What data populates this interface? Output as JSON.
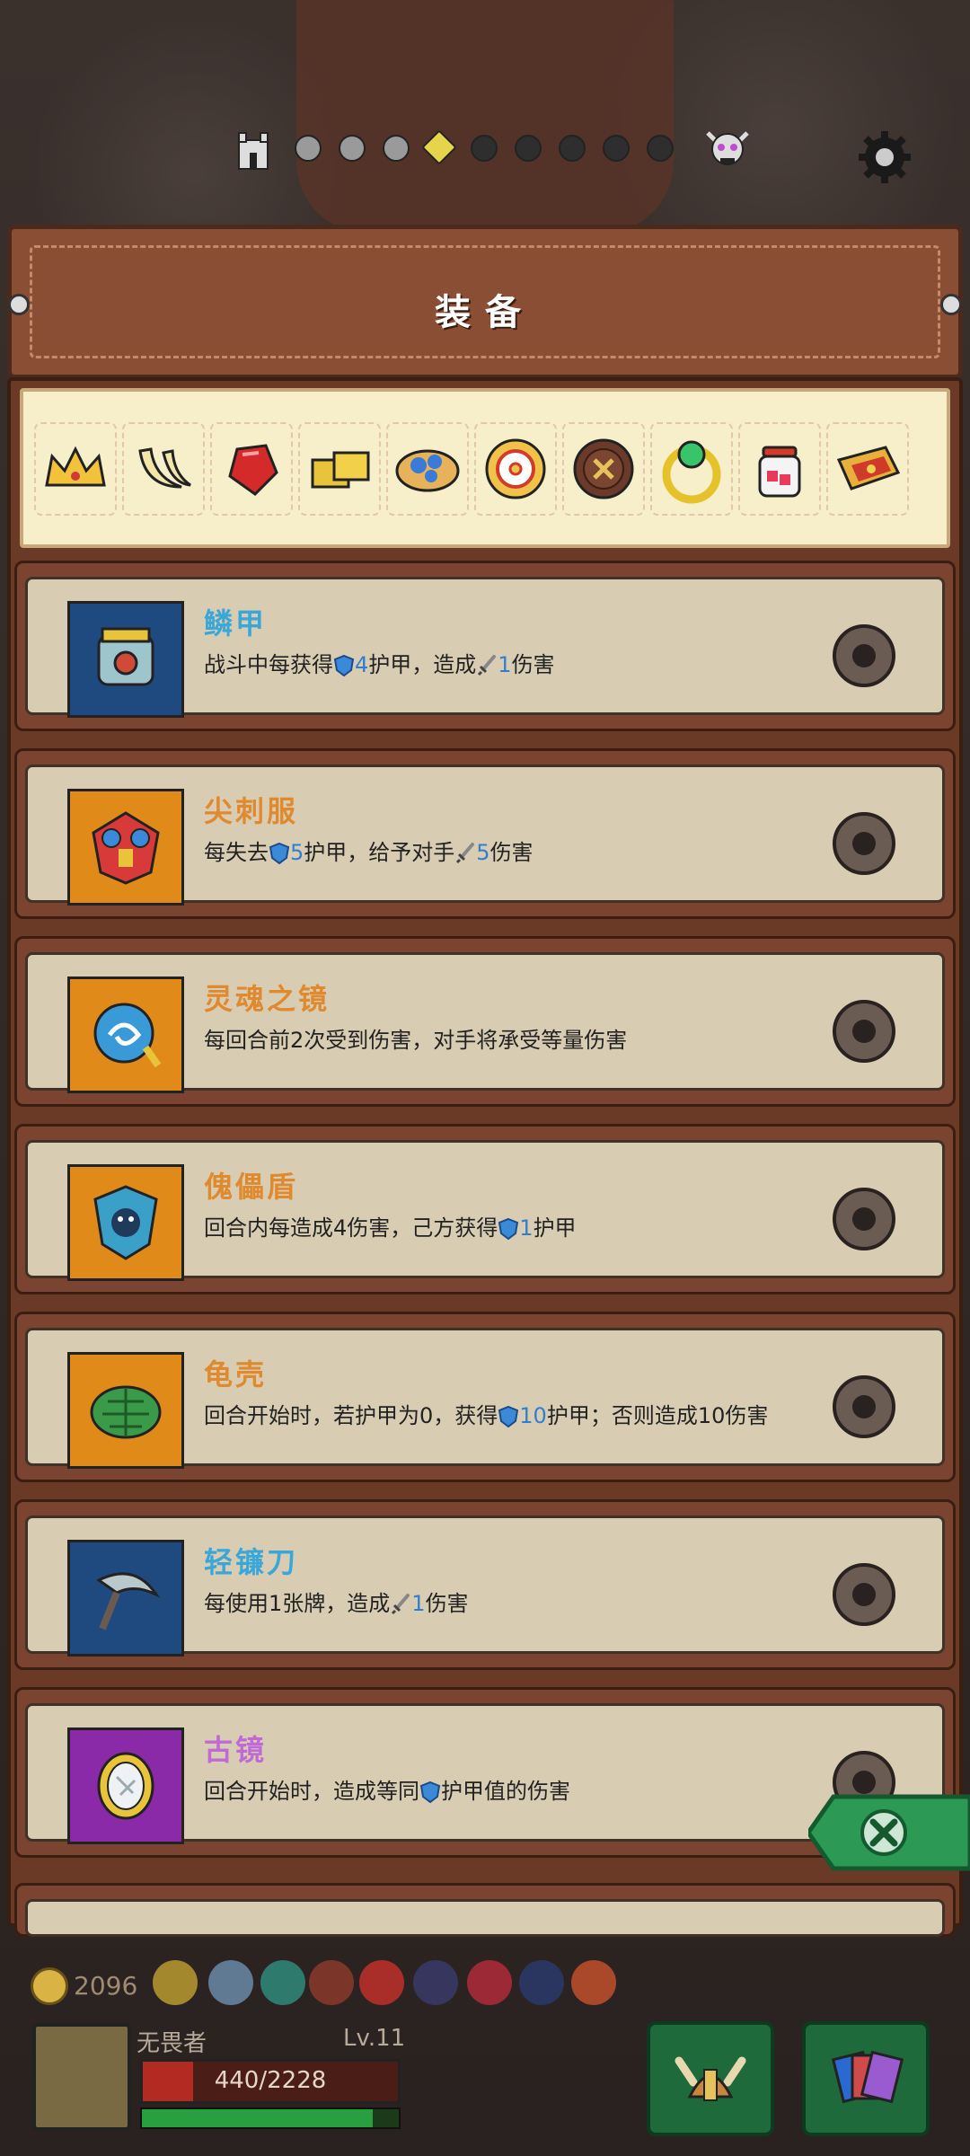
{
  "header": {
    "title": "装备"
  },
  "progress": {
    "total_nodes": 9,
    "current_index": 3,
    "visited": 3
  },
  "relics": [
    "crown-icon",
    "banana-icon",
    "ruby-icon",
    "gold-bars-icon",
    "blue-cookie-icon",
    "ring-donut-icon",
    "button-icon",
    "emerald-ring-icon",
    "jar-icon",
    "spellbook-icon"
  ],
  "cards": [
    {
      "name": "鳞甲",
      "color": "blue",
      "icon_bg": "#1f4a80",
      "desc": [
        {
          "t": "战斗中每获得"
        },
        {
          "s": "shield"
        },
        {
          "n": "4"
        },
        {
          "t": "护甲，造成"
        },
        {
          "s": "sword"
        },
        {
          "n": "1"
        },
        {
          "t": "伤害"
        }
      ]
    },
    {
      "name": "尖刺服",
      "color": "orange",
      "icon_bg": "#e08a1a",
      "desc": [
        {
          "t": "每失去"
        },
        {
          "s": "shield"
        },
        {
          "n": "5"
        },
        {
          "t": "护甲，给予对手"
        },
        {
          "s": "sword"
        },
        {
          "n": "5"
        },
        {
          "t": "伤害"
        }
      ]
    },
    {
      "name": "灵魂之镜",
      "color": "orange",
      "icon_bg": "#e08a1a",
      "desc": [
        {
          "t": "每回合前2次受到伤害，对手将承受等量伤害"
        }
      ]
    },
    {
      "name": "傀儡盾",
      "color": "orange",
      "icon_bg": "#e08a1a",
      "desc": [
        {
          "t": "回合内每造成4伤害，己方获得"
        },
        {
          "s": "shield"
        },
        {
          "n": "1"
        },
        {
          "t": "护甲"
        }
      ]
    },
    {
      "name": "龟壳",
      "color": "orange",
      "icon_bg": "#e08a1a",
      "desc": [
        {
          "t": "回合开始时，若护甲为0，获得"
        },
        {
          "s": "shield"
        },
        {
          "n": "10"
        },
        {
          "t": "护甲；否则造成10伤害"
        }
      ]
    },
    {
      "name": "轻镰刀",
      "color": "blue",
      "icon_bg": "#1f4a80",
      "desc": [
        {
          "t": "每使用1张牌，造成"
        },
        {
          "s": "sword"
        },
        {
          "n": "1"
        },
        {
          "t": "伤害"
        }
      ]
    },
    {
      "name": "古镜",
      "color": "purple",
      "icon_bg": "#8a2aa8",
      "desc": [
        {
          "t": "回合开始时，造成等同"
        },
        {
          "s": "shield"
        },
        {
          "t": "护甲值的伤害"
        }
      ]
    }
  ],
  "player": {
    "coins": "2096",
    "name": "无畏者",
    "level": "Lv.11",
    "hp_text": "440/2228",
    "hp": 440,
    "hp_max": 2228,
    "xp_fraction": 0.9
  },
  "colors": {
    "blue": "#3aa7d8",
    "orange": "#e08a30",
    "purple": "#c06ad6"
  }
}
